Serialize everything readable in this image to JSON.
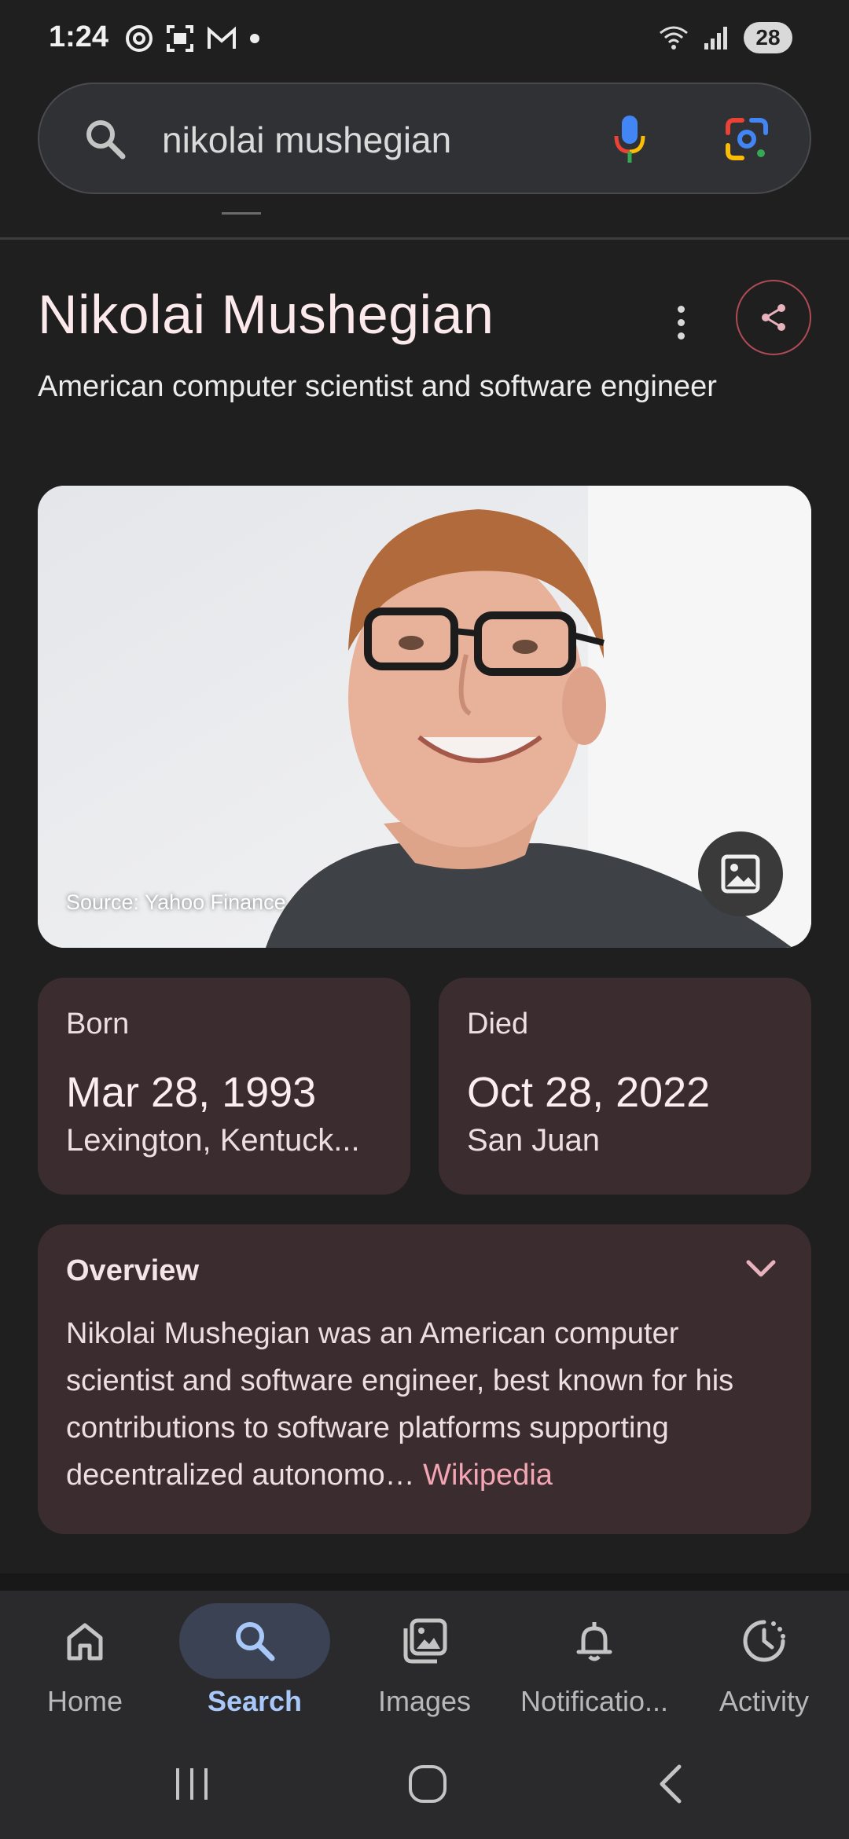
{
  "status_bar": {
    "time": "1:24",
    "battery": "28",
    "left_icons": [
      "threads-icon",
      "screenshot-icon",
      "gmail-icon",
      "dot-icon"
    ],
    "right_icons": [
      "wifi-icon",
      "signal-icon",
      "battery-icon"
    ]
  },
  "search": {
    "query": "nikolai mushegian"
  },
  "knowledge_panel": {
    "title": "Nikolai Mushegian",
    "subtitle": "American computer scientist and software engineer",
    "image_source": "Source: Yahoo Finance",
    "facts": {
      "born": {
        "label": "Born",
        "date": "Mar 28, 1993",
        "place": "Lexington, Kentuck..."
      },
      "died": {
        "label": "Died",
        "date": "Oct 28, 2022",
        "place": "San Juan"
      }
    },
    "overview": {
      "title": "Overview",
      "text": "Nikolai Mushegian was an American computer scientist and software engineer, best known for his contributions to software platforms supporting decentralized autonomo…",
      "source_link": "Wikipedia"
    }
  },
  "bottom_nav": {
    "items": [
      {
        "label": "Home",
        "icon": "home-icon"
      },
      {
        "label": "Search",
        "icon": "search-icon"
      },
      {
        "label": "Images",
        "icon": "images-icon"
      },
      {
        "label": "Notificatio...",
        "icon": "bell-icon"
      },
      {
        "label": "Activity",
        "icon": "activity-icon"
      }
    ],
    "active": "Search"
  },
  "colors": {
    "background": "#1f1f1f",
    "card": "#3b2d2f",
    "accent_link": "#f4a5b4",
    "active_nav": "#a8c8fa"
  }
}
